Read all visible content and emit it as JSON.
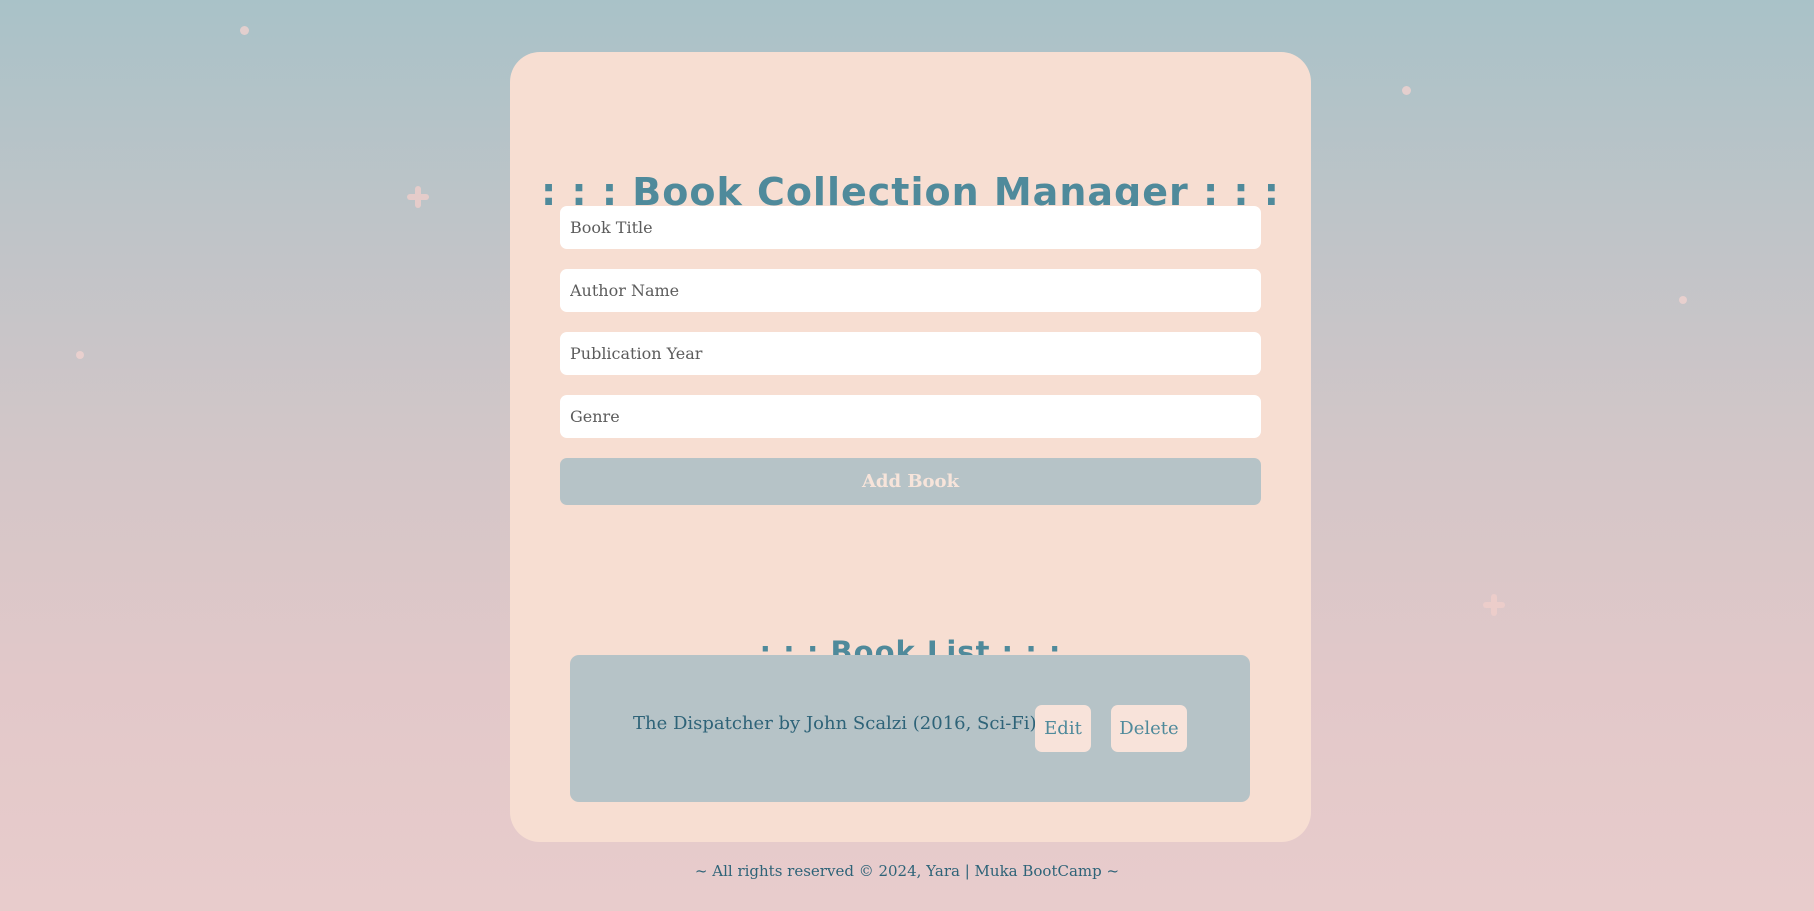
{
  "app": {
    "title": ": : : Book Collection Manager : : :"
  },
  "form": {
    "title_placeholder": "Book Title",
    "author_placeholder": "Author Name",
    "year_placeholder": "Publication Year",
    "genre_placeholder": "Genre",
    "add_label": "Add Book"
  },
  "list": {
    "title": ": : : Book List : : :",
    "books": [
      {
        "text": "The Dispatcher by John Scalzi (2016, Sci-Fi)",
        "edit_label": "Edit",
        "delete_label": "Delete"
      }
    ]
  },
  "footer": {
    "text": "~ All rights reserved © 2024, Yara | Muka BootCamp ~"
  },
  "colors": {
    "accent": "#4f8a9b",
    "card": "#f7ded2",
    "button": "#b6c3c7",
    "dark_text": "#2e6378"
  }
}
